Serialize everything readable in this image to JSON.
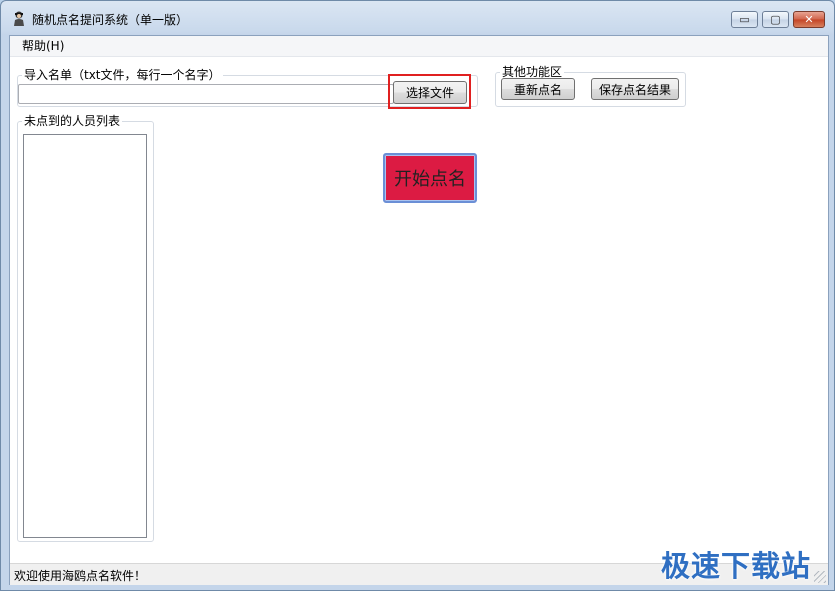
{
  "window": {
    "title": "随机点名提问系统（单一版）",
    "controls": {
      "minimize": "▭",
      "maximize": "▢",
      "close": "✕"
    }
  },
  "menu": {
    "help": "帮助(H)"
  },
  "import": {
    "legend": "导入名单（txt文件，每行一个名字）",
    "file_path_value": "",
    "select_button": "选择文件"
  },
  "functions": {
    "legend": "其他功能区",
    "redo_button": "重新点名",
    "save_button": "保存点名结果"
  },
  "list": {
    "legend": "未点到的人员列表",
    "items": []
  },
  "start_button": "开始点名",
  "status": {
    "text": "欢迎使用海鸥点名软件！"
  },
  "watermark": "极速下载站",
  "colors": {
    "start_button_bg": "#dc1b43",
    "highlight_border": "#e02020",
    "watermark": "#2f6fc2"
  }
}
